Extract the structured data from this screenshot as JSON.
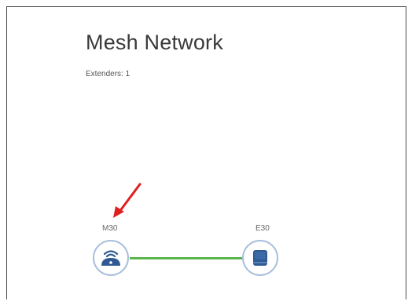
{
  "page": {
    "title": "Mesh Network",
    "extenders_label": "Extenders: 1"
  },
  "nodes": [
    {
      "label": "M30",
      "icon": "router-wifi-icon"
    },
    {
      "label": "E30",
      "icon": "extender-icon"
    }
  ],
  "colors": {
    "link": "#5ab54b",
    "node_border": "#a8bfdc",
    "device": "#2f5a92",
    "arrow": "#e02020"
  }
}
